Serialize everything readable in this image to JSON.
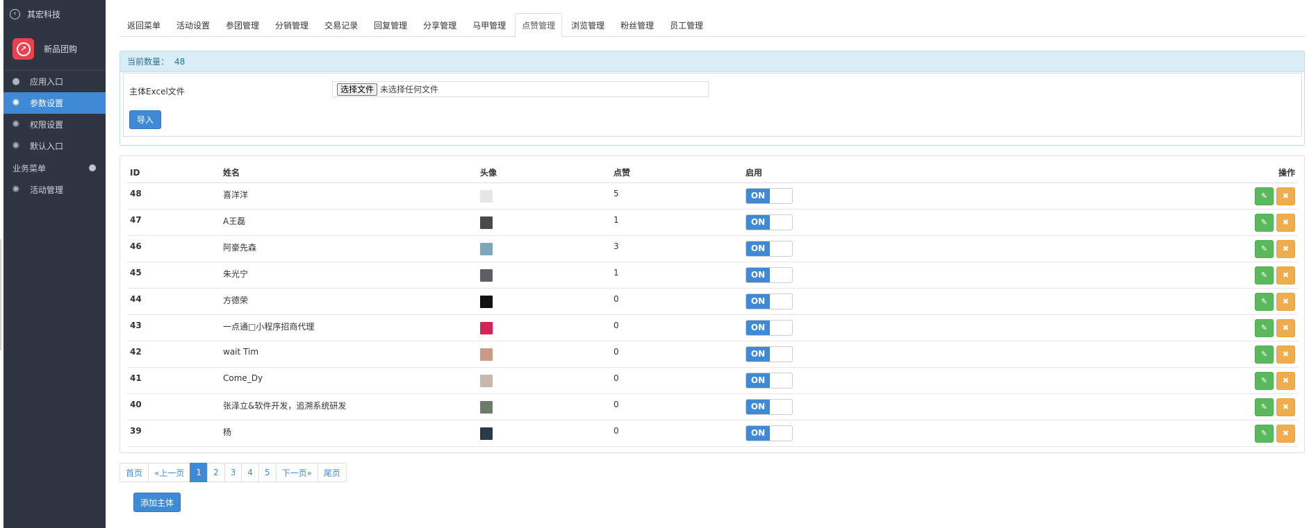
{
  "sidebar": {
    "brand": "其宏科技",
    "app_name": "新品团购",
    "items": [
      {
        "label": "应用入口",
        "icon": "chat-bubble-icon",
        "active": false
      },
      {
        "label": "参数设置",
        "icon": "gear-icon",
        "active": true
      },
      {
        "label": "权限设置",
        "icon": "gear-icon",
        "active": false
      },
      {
        "label": "默认入口",
        "icon": "gear-icon",
        "active": false
      }
    ],
    "section": "业务菜单",
    "section_items": [
      {
        "label": "活动管理",
        "icon": "gear-icon"
      }
    ]
  },
  "tabs": [
    "返回菜单",
    "活动设置",
    "参团管理",
    "分销管理",
    "交易记录",
    "回复管理",
    "分享管理",
    "马甲管理",
    "点赞管理",
    "浏览管理",
    "粉丝管理",
    "员工管理"
  ],
  "active_tab": "点赞管理",
  "import_panel": {
    "count_label": "当前数量：",
    "count_value": "48",
    "file_label": "主体Excel文件",
    "file_button": "选择文件",
    "file_status": "未选择任何文件",
    "import_button": "导入"
  },
  "table": {
    "headers": {
      "id": "ID",
      "name": "姓名",
      "avatar": "头像",
      "likes": "点赞",
      "enabled": "启用",
      "actions": "操作"
    },
    "toggle_on_label": "ON",
    "rows": [
      {
        "id": "48",
        "name": "喜洋洋",
        "likes": "5",
        "avatar_color": "#e6e6e6"
      },
      {
        "id": "47",
        "name": "A王磊",
        "likes": "1",
        "avatar_color": "#4a4a4a"
      },
      {
        "id": "46",
        "name": "阿豪先森",
        "likes": "3",
        "avatar_color": "#7fa6b8"
      },
      {
        "id": "45",
        "name": "朱光宁",
        "likes": "1",
        "avatar_color": "#5c5f66"
      },
      {
        "id": "44",
        "name": "方德荣",
        "likes": "0",
        "avatar_color": "#111111"
      },
      {
        "id": "43",
        "name": "一点通□小程序招商代理",
        "likes": "0",
        "avatar_color": "#d6245a"
      },
      {
        "id": "42",
        "name": "wait Tim",
        "likes": "0",
        "avatar_color": "#c99a86"
      },
      {
        "id": "41",
        "name": "Come_Dy",
        "likes": "0",
        "avatar_color": "#c8b7aa"
      },
      {
        "id": "40",
        "name": "张泽立&软件开发，追溯系统研发",
        "likes": "0",
        "avatar_color": "#6d7b6a"
      },
      {
        "id": "39",
        "name": "杨",
        "likes": "0",
        "avatar_color": "#2b3a4a"
      }
    ]
  },
  "pagination": [
    "首页",
    "«上一页",
    "1",
    "2",
    "3",
    "4",
    "5",
    "下一页»",
    "尾页"
  ],
  "pagination_active": "1",
  "add_button": "添加主体",
  "colors": {
    "primary": "#3f8ad6",
    "sidebar_bg": "#2f3542",
    "success": "#5cb85c",
    "warning": "#f0ad4e",
    "info_bg": "#d9edf7"
  }
}
